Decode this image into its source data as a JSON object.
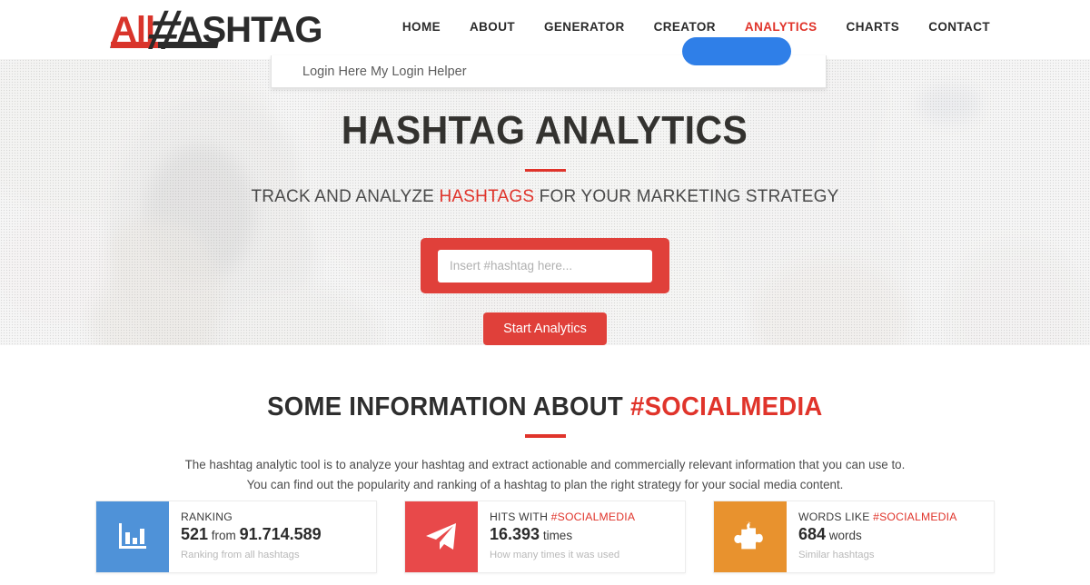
{
  "header": {
    "logo": {
      "part1": "All",
      "part2": "#",
      "part3": "ASHTAG"
    },
    "nav": [
      {
        "label": "HOME",
        "active": false
      },
      {
        "label": "ABOUT",
        "active": false
      },
      {
        "label": "GENERATOR",
        "active": false
      },
      {
        "label": "CREATOR",
        "active": false
      },
      {
        "label": "ANALYTICS",
        "active": true
      },
      {
        "label": "CHARTS",
        "active": false
      },
      {
        "label": "CONTACT",
        "active": false
      }
    ]
  },
  "login_overlay": {
    "text": "Login Here My Login Helper",
    "button_color": "#2f7fe8"
  },
  "hero": {
    "title": "HASHTAG ANALYTICS",
    "subtitle_pre": "TRACK AND ANALYZE ",
    "subtitle_highlight": "HASHTAGS",
    "subtitle_post": " FOR YOUR MARKETING STRATEGY",
    "search_placeholder": "Insert #hashtag here...",
    "search_value": "",
    "button_label": "Start Analytics",
    "accent_color": "#e0403a"
  },
  "info": {
    "title_pre": "SOME INFORMATION ABOUT ",
    "title_highlight": "#SOCIALMEDIA",
    "desc_line1": "The hashtag analytic tool is to analyze your hashtag and extract actionable and commercially relevant information that you can use to.",
    "desc_line2": "You can find out the popularity and ranking of a hashtag to plan the right strategy for your social media content."
  },
  "cards": [
    {
      "icon": "bar-chart-icon",
      "color": "#4f92d8",
      "label_pre": "RANKING",
      "label_highlight": "",
      "value_main": "521",
      "value_mid": " from ",
      "value_second": "91.714.589",
      "note": "Ranking from all hashtags"
    },
    {
      "icon": "paper-plane-icon",
      "color": "#e8494a",
      "label_pre": "HITS WITH ",
      "label_highlight": "#SOCIALMEDIA",
      "value_main": "16.393",
      "value_mid": " times",
      "value_second": "",
      "note": "How many times it was used"
    },
    {
      "icon": "puzzle-piece-icon",
      "color": "#e8922e",
      "label_pre": "WORDS LIKE ",
      "label_highlight": "#SOCIALMEDIA",
      "value_main": "684",
      "value_mid": " words",
      "value_second": "",
      "note": "Similar hashtags"
    }
  ]
}
